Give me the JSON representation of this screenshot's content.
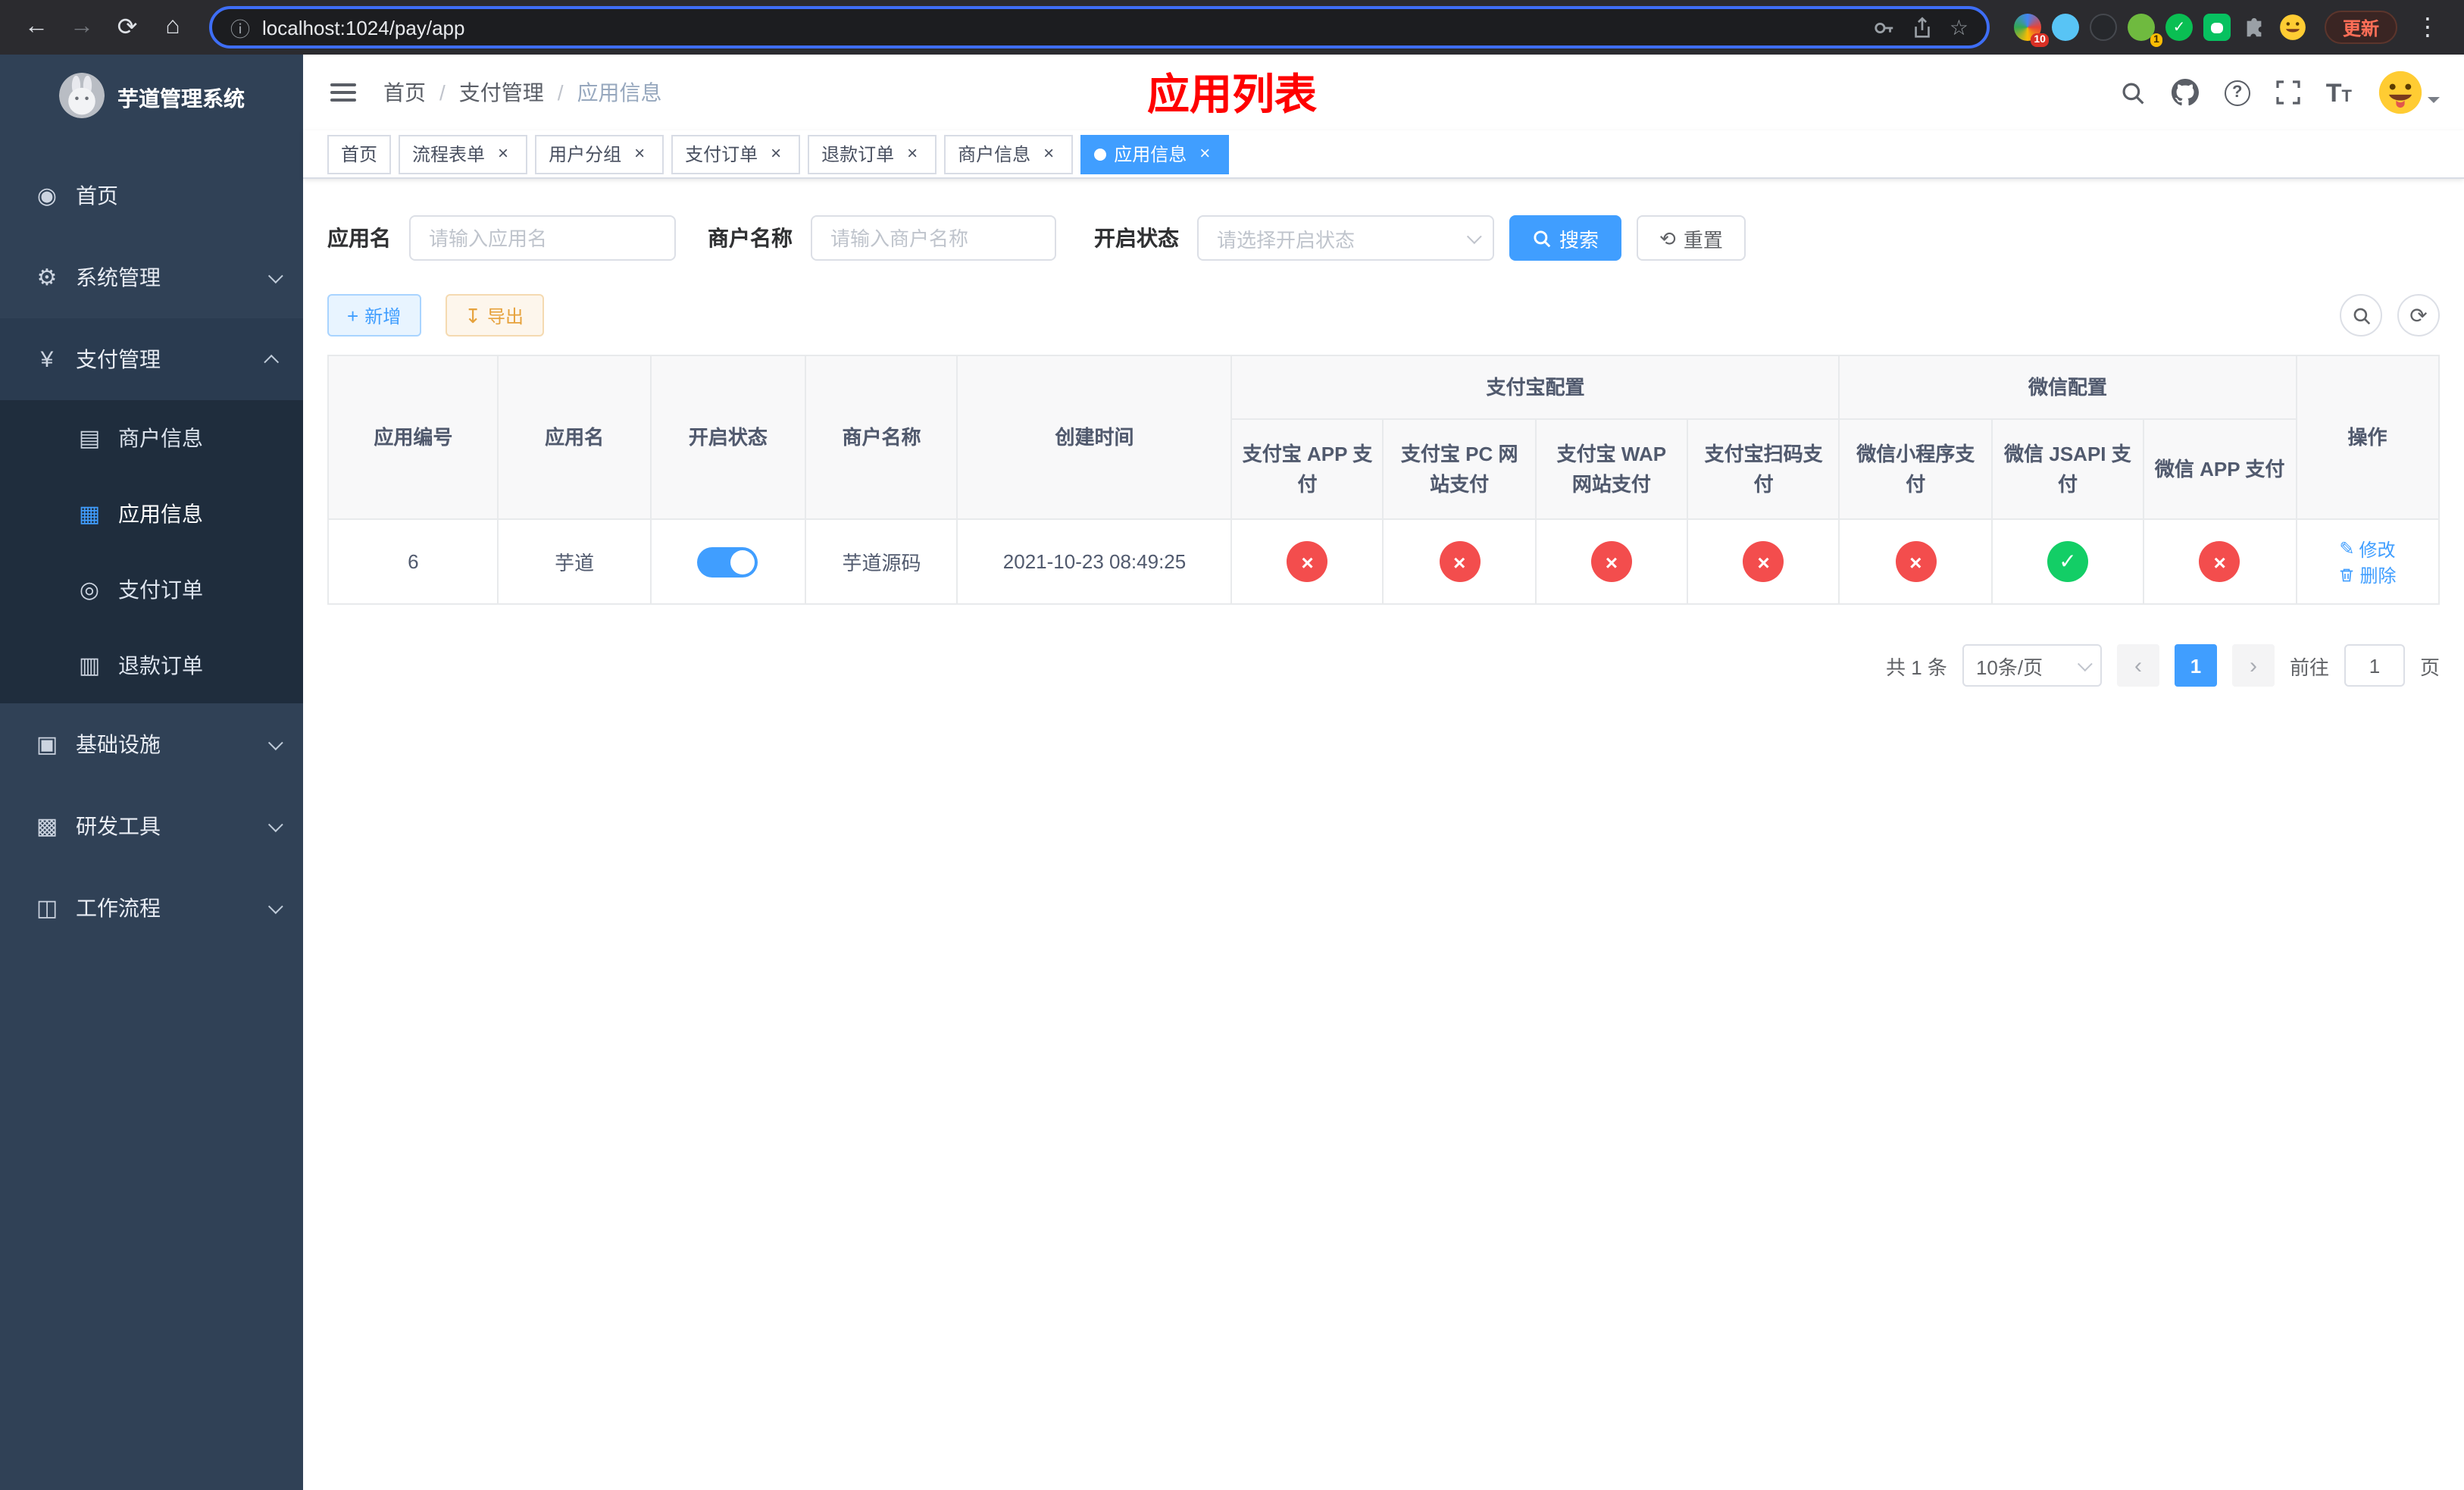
{
  "colors": {
    "accent": "#409eff",
    "danger": "#f34d4d",
    "success": "#13ce66",
    "page_title_red": "#ff0000",
    "sidebar_bg": "#304156",
    "submenu_bg": "#1f2d3d"
  },
  "icons": {
    "back": "←",
    "forward": "→",
    "reload": "⟳",
    "home": "⌂",
    "info": "ⓘ",
    "star": "☆",
    "dots": "⋮",
    "dashboard": "◉",
    "gear": "⚙",
    "yen": "¥",
    "card": "▤",
    "grid": "▦",
    "order": "◎",
    "refund": "▥",
    "infra": "▣",
    "tools": "▩",
    "flow": "◫",
    "plus": "+",
    "download": "↧",
    "reset": "⟲",
    "check": "✓",
    "cross": "×",
    "close": "×",
    "edit": "✎",
    "question": "?",
    "prev": "‹",
    "next": "›",
    "ext_check": "✓"
  },
  "browser": {
    "url": "localhost:1024/pay/app",
    "update_label": "更新",
    "extension_badges": {
      "first": "10",
      "second": "1"
    }
  },
  "sidebar": {
    "app_title": "芋道管理系统",
    "menu": [
      {
        "label": "首页"
      },
      {
        "label": "系统管理"
      },
      {
        "label": "支付管理"
      },
      {
        "label": "商户信息"
      },
      {
        "label": "应用信息"
      },
      {
        "label": "支付订单"
      },
      {
        "label": "退款订单"
      },
      {
        "label": "基础设施"
      },
      {
        "label": "研发工具"
      },
      {
        "label": "工作流程"
      }
    ]
  },
  "navbar": {
    "breadcrumb": [
      "首页",
      "支付管理",
      "应用信息"
    ],
    "page_title": "应用列表"
  },
  "tabs": [
    {
      "label": "首页"
    },
    {
      "label": "流程表单"
    },
    {
      "label": "用户分组"
    },
    {
      "label": "支付订单"
    },
    {
      "label": "退款订单"
    },
    {
      "label": "商户信息"
    },
    {
      "label": "应用信息"
    }
  ],
  "filters": {
    "app_name": {
      "label": "应用名",
      "placeholder": "请输入应用名"
    },
    "merchant_name": {
      "label": "商户名称",
      "placeholder": "请输入商户名称"
    },
    "status": {
      "label": "开启状态",
      "placeholder": "请选择开启状态"
    },
    "search_label": "搜索",
    "reset_label": "重置"
  },
  "toolbar": {
    "add_label": "新增",
    "export_label": "导出"
  },
  "table": {
    "columns": {
      "app_id": "应用编号",
      "app_name": "应用名",
      "status": "开启状态",
      "merchant_name": "商户名称",
      "created_at": "创建时间",
      "alipay_group": "支付宝配置",
      "wechat_group": "微信配置",
      "alipay_app": "支付宝 APP 支付",
      "alipay_pc": "支付宝 PC 网站支付",
      "alipay_wap": "支付宝 WAP 网站支付",
      "alipay_qr": "支付宝扫码支付",
      "wx_lite": "微信小程序支付",
      "wx_jsapi": "微信 JSAPI 支付",
      "wx_app": "微信 APP 支付",
      "actions": "操作"
    },
    "rows": [
      {
        "app_id": "6",
        "app_name": "芋道",
        "status_on": true,
        "merchant_name": "芋道源码",
        "created_at": "2021-10-23 08:49:25",
        "configs": {
          "alipay_app": false,
          "alipay_pc": false,
          "alipay_wap": false,
          "alipay_qr": false,
          "wx_lite": false,
          "wx_jsapi": true,
          "wx_app": false
        },
        "edit_label": "修改",
        "delete_label": "删除"
      }
    ]
  },
  "pagination": {
    "total_text": "共 1 条",
    "page_size": "10条/页",
    "current_page": "1",
    "goto_label": "前往",
    "goto_value": "1",
    "page_unit": "页"
  }
}
